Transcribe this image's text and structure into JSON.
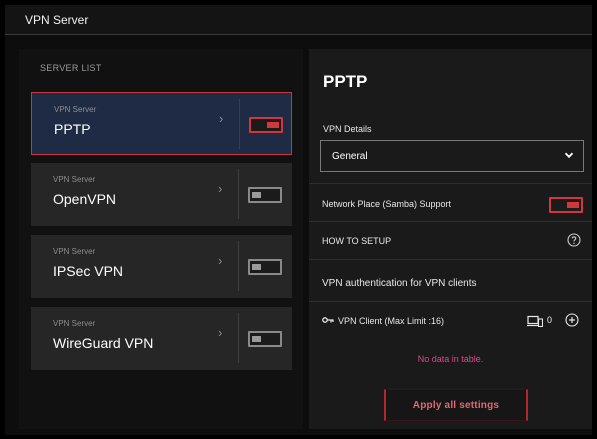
{
  "window": {
    "title": "VPN Server"
  },
  "server_list": {
    "heading": "SERVER LIST",
    "servers": [
      {
        "subtitle": "VPN Server",
        "name": "PPTP",
        "selected": true,
        "enabled": true
      },
      {
        "subtitle": "VPN Server",
        "name": "OpenVPN",
        "selected": false,
        "enabled": false
      },
      {
        "subtitle": "VPN Server",
        "name": "IPSec VPN",
        "selected": false,
        "enabled": false
      },
      {
        "subtitle": "VPN Server",
        "name": "WireGuard VPN",
        "selected": false,
        "enabled": false
      }
    ]
  },
  "detail": {
    "title": "PPTP",
    "details_label": "VPN Details",
    "details_value": "General",
    "samba_label": "Network Place (Samba) Support",
    "samba_enabled": true,
    "howto_label": "HOW TO SETUP",
    "auth_label": "VPN authentication for VPN clients",
    "client_label": "VPN Client (Max Limit :16)",
    "client_count": "0",
    "empty_text": "No data in table.",
    "apply_label": "Apply all settings"
  },
  "colors": {
    "accent_red": "#d2373c",
    "selected_bg": "#1f2b45",
    "empty_text": "#e0458f"
  }
}
